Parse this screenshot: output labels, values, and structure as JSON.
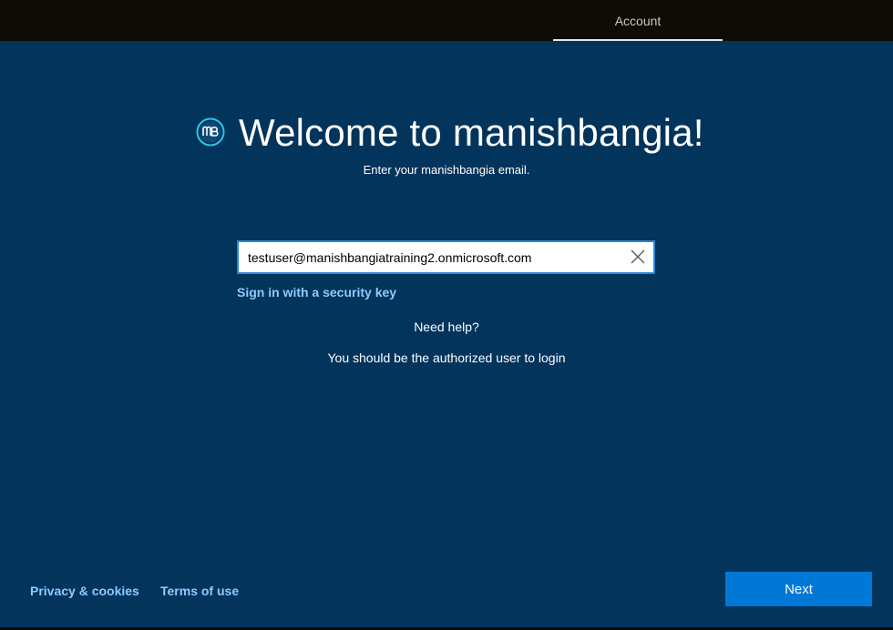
{
  "topbar": {
    "active_tab": "Account"
  },
  "header": {
    "title": "Welcome to manishbangia!",
    "subtitle": "Enter your manishbangia email.",
    "logo_icon": "mb-logo-icon"
  },
  "form": {
    "email_value": "testuser@manishbangiatraining2.onmicrosoft.com",
    "clear_icon": "close-icon",
    "security_key_link": "Sign in with a security key",
    "need_help": "Need help?",
    "authorized_note": "You should be the authorized user to login"
  },
  "footer": {
    "privacy_link": "Privacy & cookies",
    "terms_link": "Terms of use",
    "next_button": "Next"
  },
  "colors": {
    "background": "#02345c",
    "accent": "#0078d7",
    "link": "#8ccbff",
    "topbar": "#0f0c05"
  }
}
